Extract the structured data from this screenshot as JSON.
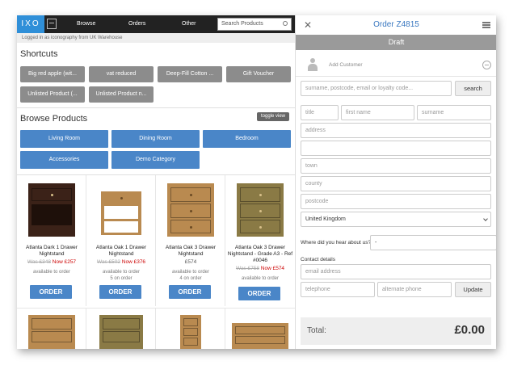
{
  "app": {
    "logo_text": "IXO"
  },
  "nav": {
    "browse": "Browse",
    "orders": "Orders",
    "other": "Other"
  },
  "search": {
    "placeholder": "Search Products"
  },
  "status": {
    "logged_in": "Logged in as iconography from UK Warehouse"
  },
  "shortcuts": {
    "title": "Shortcuts",
    "items": [
      "Big red apple (wit...",
      "vat reduced",
      "Deep-Fill Cotton ...",
      "Gift Voucher",
      "Unlisted Product (...",
      "Unlisted Product n..."
    ]
  },
  "browse": {
    "title": "Browse Products",
    "toggle_label": "toggle view",
    "categories": [
      "Living Room",
      "Dining Room",
      "Bedroom",
      "Accessories",
      "Demo Category"
    ]
  },
  "products": [
    {
      "name": "Atlanta Dark 1 Drawer Nightstand",
      "was": "Was £348",
      "now": "Now £257",
      "avail1": "available to order",
      "avail2": "",
      "order_label": "ORDER"
    },
    {
      "name": "Atlanta Oak 1 Drawer Nightstand",
      "was": "Was £502",
      "now": "Now £376",
      "avail1": "available to order",
      "avail2": "5 on order",
      "order_label": "ORDER"
    },
    {
      "name": "Atlanta Oak 3 Drawer Nightstand",
      "price": "£574",
      "avail1": "available to order",
      "avail2": "4 on order",
      "order_label": "ORDER"
    },
    {
      "name": "Atlanta Oak 3 Drawer Nightstand - Grade A3 - Ref #0046",
      "was": "Was £758",
      "now": "Now £574",
      "avail1": "available to order",
      "avail2": "",
      "order_label": "ORDER"
    }
  ],
  "order": {
    "title": "Order Z4815",
    "status": "Draft",
    "add_customer": "Add Customer",
    "customer_search_placeholder": "surname, postcode, email or loyalty code...",
    "search_button": "search",
    "title_placeholder": "title",
    "first_name_placeholder": "first name",
    "surname_placeholder": "surname",
    "address_placeholder": "address",
    "address2_placeholder": "",
    "town_placeholder": "town",
    "county_placeholder": "county",
    "postcode_placeholder": "postcode",
    "country": "United Kingdom",
    "hear_about_label": "Where did you hear about us?",
    "hear_about_value": "-",
    "contact_label": "Contact details",
    "email_placeholder": "email address",
    "telephone_placeholder": "telephone",
    "alt_phone_placeholder": "alternate phone",
    "update_button": "Update",
    "total_label": "Total:",
    "total_value": "£0.00"
  }
}
